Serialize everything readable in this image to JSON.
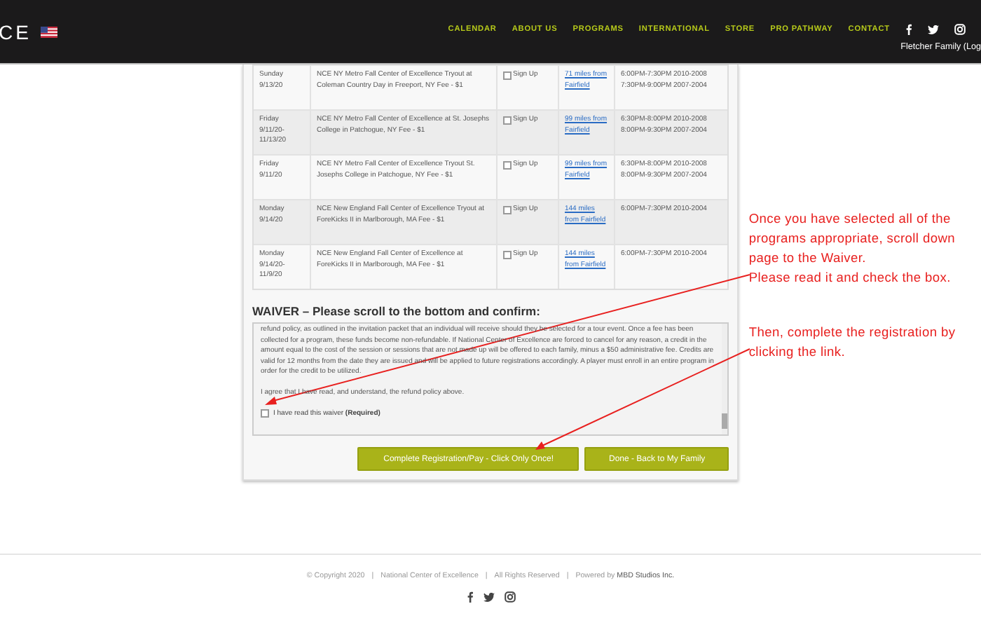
{
  "header": {
    "logo": "CE",
    "nav": [
      "CALENDAR",
      "ABOUT US",
      "PROGRAMS",
      "INTERNATIONAL",
      "STORE",
      "PRO PATHWAY",
      "CONTACT"
    ],
    "account": "Fletcher Family (Log"
  },
  "programs": [
    {
      "date": "Sunday\n9/13/20",
      "description": "NCE NY Metro Fall Center of Excellence Tryout at Coleman Country Day in Freeport, NY Fee - $1",
      "signup": "Sign Up",
      "checked": false,
      "distance": "71 miles from Fairfield",
      "times": [
        "6:00PM-7:30PM 2010-2008",
        "7:30PM-9:00PM 2007-2004"
      ]
    },
    {
      "date": "Friday\n9/11/20-\n11/13/20",
      "description": "NCE NY Metro Fall Center of Excellence at St. Josephs College in Patchogue, NY Fee - $1",
      "signup": "Sign Up",
      "checked": false,
      "distance": "99 miles from Fairfield",
      "times": [
        "6:30PM-8:00PM 2010-2008",
        "8:00PM-9:30PM 2007-2004"
      ]
    },
    {
      "date": "Friday\n9/11/20",
      "description": "NCE NY Metro Fall Center of Excellence Tryout St. Josephs College in Patchogue, NY Fee - $1",
      "signup": "Sign Up",
      "checked": false,
      "distance": "99 miles from Fairfield",
      "times": [
        "6:30PM-8:00PM 2010-2008",
        "8:00PM-9:30PM 2007-2004"
      ]
    },
    {
      "date": "Monday\n9/14/20",
      "description": "NCE New England Fall Center of Excellence Tryout at ForeKicks II in Marlborough, MA Fee - $1",
      "signup": "Sign Up",
      "checked": false,
      "distance": "144 miles from Fairfield",
      "times": [
        "6:00PM-7:30PM 2010-2004"
      ]
    },
    {
      "date": "Monday\n9/14/20-\n11/9/20",
      "description": "NCE New England Fall Center of Excellence at ForeKicks II in Marlborough, MA Fee - $1",
      "signup": "Sign Up",
      "checked": false,
      "distance": "144 miles from Fairfield",
      "times": [
        "6:00PM-7:30PM 2010-2004"
      ]
    }
  ],
  "waiver": {
    "title": "WAIVER – Please scroll to the bottom and confirm:",
    "paragraphs": [
      "refund policy, as outlined in the invitation packet that an individual will receive should they be selected for a tour event. Once a fee has been collected for a program, these funds become non-refundable. If National Center of Excellence are forced to cancel for any reason, a credit in the amount equal to the cost of the session or sessions that are not made up will be offered to each family, minus a $50 administrative fee. Credits are valid for 12 months from the date they are issued and will be applied to future registrations accordingly. A player must enroll in an entire program in order for the credit to be utilized.",
      "I agree that I have read, and understand, the refund policy above."
    ],
    "confirm": "I have read this waiver **(Required)**",
    "checked": false
  },
  "buttons": [
    "Complete Registration/Pay - Click Only Once!",
    "Done - Back to My Family"
  ],
  "annotations": [
    "Once you have selected all of the programs appropriate, scroll down page to the Waiver.\nPlease read it and check the box.",
    "Then, complete the registration by clicking the link."
  ],
  "footer": {
    "parts": [
      "© Copyright 2020",
      "National Center of Excellence",
      "All Rights Reserved",
      "Powered by **MBD Studios Inc.**"
    ],
    "separator": "|"
  }
}
